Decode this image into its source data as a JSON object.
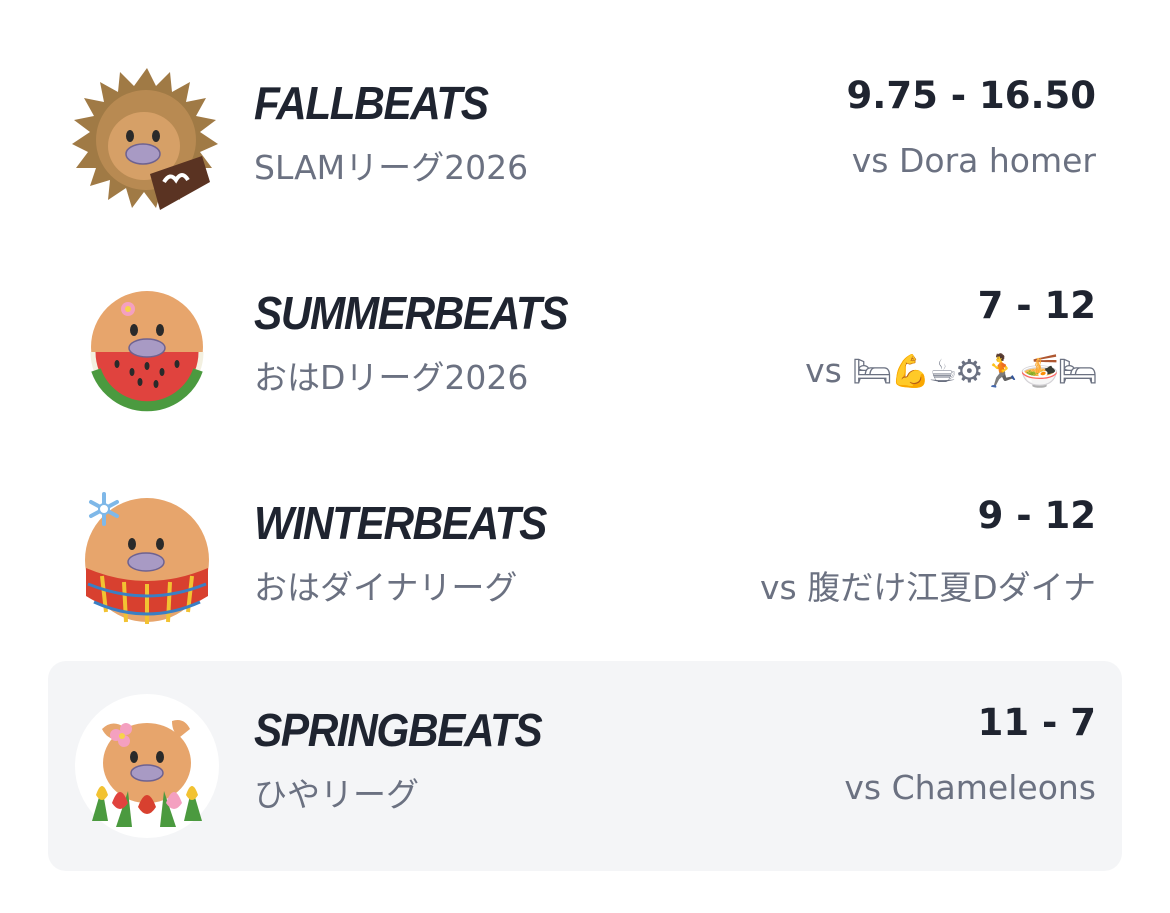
{
  "teams": [
    {
      "name": "FALLBEATS",
      "league": "SLAMリーグ2026",
      "score": "9.75 - 16.50",
      "opponent": "vs Dora homer",
      "avatar_icon": "hedgehog-platypus-chocolate-icon",
      "selected": false
    },
    {
      "name": "SUMMERBEATS",
      "league": "おはDリーグ2026",
      "score": "7 - 12",
      "opponent_prefix": "vs",
      "opponent_emoji": "🛏💪☕⚙🏃🍜🛏",
      "avatar_icon": "platypus-watermelon-icon",
      "selected": false
    },
    {
      "name": "WINTERBEATS",
      "league": "おはダイナリーグ",
      "score": "9 - 12",
      "opponent": "vs 腹だけ江夏Dダイナ",
      "avatar_icon": "platypus-snowflake-scarf-icon",
      "selected": false
    },
    {
      "name": "SPRINGBEATS",
      "league": "ひやリーグ",
      "score": "11 - 7",
      "opponent": "vs Chameleons",
      "avatar_icon": "platypus-tulips-icon",
      "selected": true
    }
  ],
  "colors": {
    "title": "#1f2430",
    "subtitle": "#6b7181",
    "selected_row_bg": "#f4f5f7",
    "platypus_face": "#e7a56c",
    "bill": "#a89ac4"
  }
}
